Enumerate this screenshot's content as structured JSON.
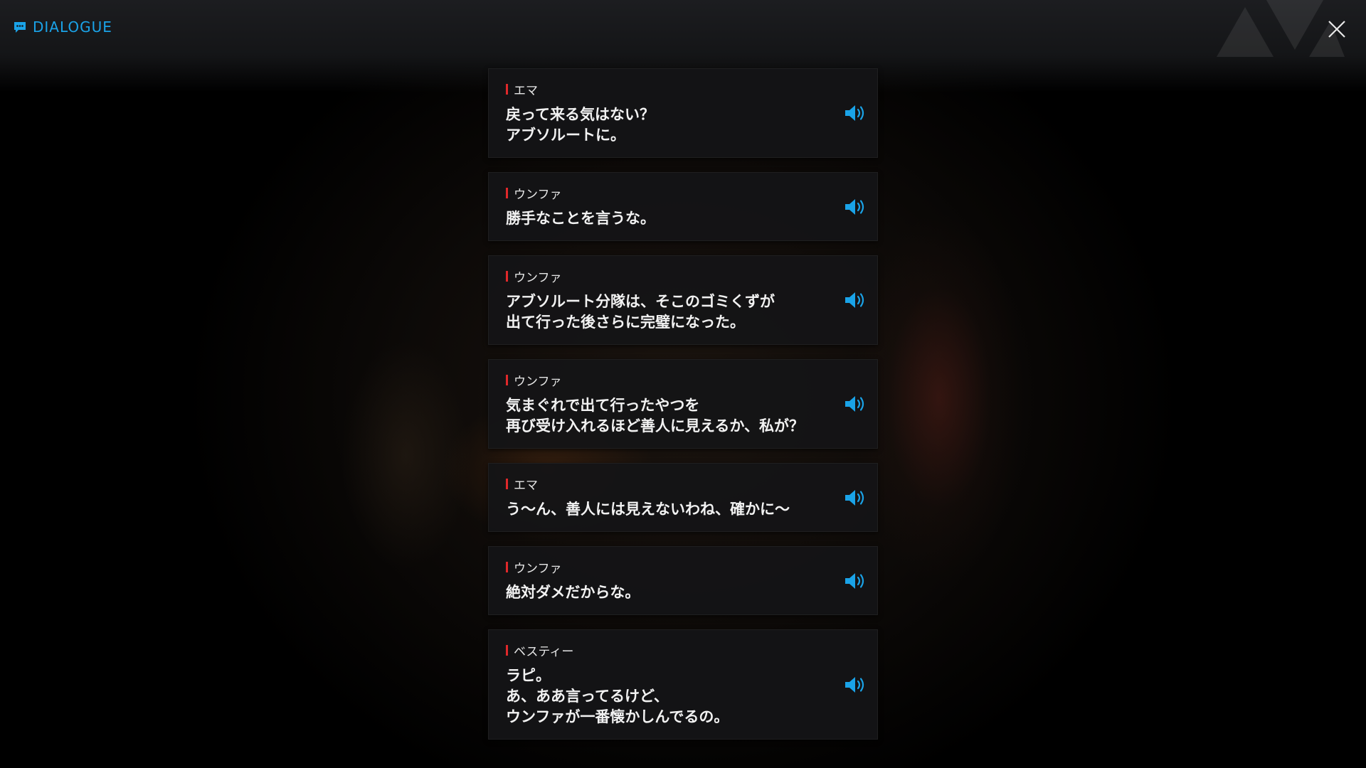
{
  "header": {
    "title": "DIALOGUE",
    "accent_color": "#1aa3e8"
  },
  "icons": {
    "header": "chat-bubble-icon",
    "close": "close-icon",
    "voice": "speaker-volume-icon"
  },
  "dialogue": [
    {
      "speaker": "エマ",
      "lines": [
        "戻って来る気はない？",
        "アブソルートに。"
      ]
    },
    {
      "speaker": "ウンファ",
      "lines": [
        "勝手なことを言うな。"
      ]
    },
    {
      "speaker": "ウンファ",
      "lines": [
        "アブソルート分隊は、そこのゴミくずが",
        "出て行った後さらに完璧になった。"
      ]
    },
    {
      "speaker": "ウンファ",
      "lines": [
        "気まぐれで出て行ったやつを",
        "再び受け入れるほど善人に見えるか、私が？"
      ]
    },
    {
      "speaker": "エマ",
      "lines": [
        "う～ん、善人には見えないわね、確かに～"
      ]
    },
    {
      "speaker": "ウンファ",
      "lines": [
        "絶対ダメだからな。"
      ]
    },
    {
      "speaker": "ベスティー",
      "lines": [
        "ラピ。",
        "あ、ああ言ってるけど、",
        "ウンファが一番懐かしんでるの。"
      ]
    }
  ],
  "colors": {
    "speaker_marker": "#e0282a",
    "voice_icon": "#1aa3e8"
  }
}
